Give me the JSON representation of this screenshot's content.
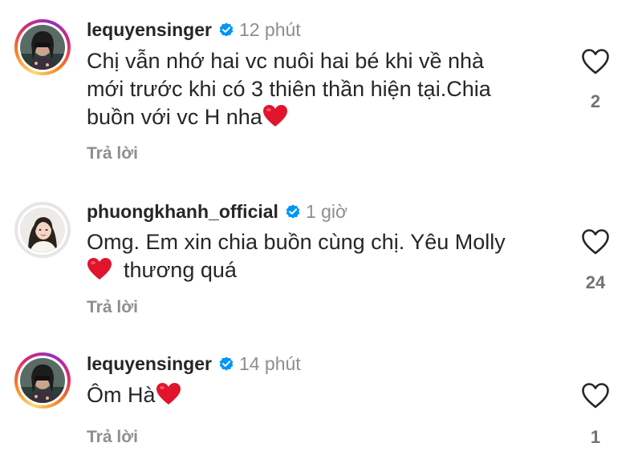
{
  "comments": [
    {
      "username": "lequyensinger",
      "time": "12 phút",
      "lines": [
        "Chị vẫn nhớ hai vc nuôi hai bé khi về nhà",
        "mới trước khi có 3 thiên thần hiện tại.Chia",
        "buồn với vc H nha"
      ],
      "reply_label": "Trả lời",
      "like_count": "2"
    },
    {
      "username": "phuongkhanh_official",
      "time": "1 giờ",
      "lines": [
        "Omg. Em xin chia buồn cùng chị. Yêu Molly",
        "thương quá"
      ],
      "reply_label": "Trả lời",
      "like_count": "24"
    },
    {
      "username": "lequyensinger",
      "time": "14 phút",
      "lines": [
        "Ôm Hà"
      ],
      "reply_label": "Trả lời",
      "like_count": "1"
    }
  ],
  "colors": {
    "verified_badge": "#0095f6",
    "heart_emoji": "#e0152d",
    "secondary_text": "#8e8e8e",
    "primary_text": "#262626"
  },
  "icons": {
    "like": "heart-outline-icon",
    "verified": "verified-badge-icon",
    "emoji": "red-heart-emoji"
  }
}
